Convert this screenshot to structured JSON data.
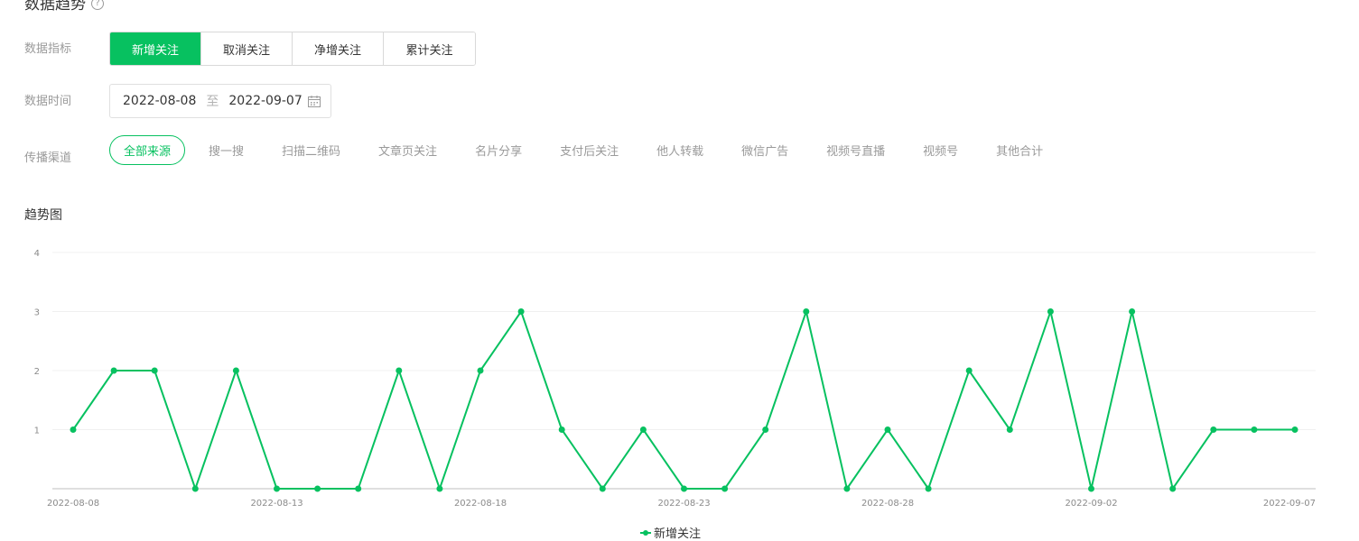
{
  "section": {
    "title": "数据趋势",
    "help_icon": "?"
  },
  "metric": {
    "label": "数据指标",
    "options": [
      "新增关注",
      "取消关注",
      "净增关注",
      "累计关注"
    ],
    "selected": "新增关注"
  },
  "date": {
    "label": "数据时间",
    "start": "2022-08-08",
    "separator": "至",
    "end": "2022-09-07",
    "icon": "calendar-icon"
  },
  "channel": {
    "label": "传播渠道",
    "options": [
      "全部来源",
      "搜一搜",
      "扫描二维码",
      "文章页关注",
      "名片分享",
      "支付后关注",
      "他人转载",
      "微信广告",
      "视频号直播",
      "视频号",
      "其他合计"
    ],
    "selected": "全部来源"
  },
  "chart": {
    "title": "趋势图"
  },
  "colors": {
    "accent": "#07c160",
    "muted": "#9a9a9a",
    "grid": "#f0f0f0",
    "axis": "#cccccc"
  },
  "chart_data": {
    "type": "line",
    "x": [
      "2022-08-08",
      "2022-08-09",
      "2022-08-10",
      "2022-08-11",
      "2022-08-12",
      "2022-08-13",
      "2022-08-14",
      "2022-08-15",
      "2022-08-16",
      "2022-08-17",
      "2022-08-18",
      "2022-08-19",
      "2022-08-20",
      "2022-08-21",
      "2022-08-22",
      "2022-08-23",
      "2022-08-24",
      "2022-08-25",
      "2022-08-26",
      "2022-08-27",
      "2022-08-28",
      "2022-08-29",
      "2022-08-30",
      "2022-08-31",
      "2022-09-01",
      "2022-09-02",
      "2022-09-03",
      "2022-09-04",
      "2022-09-05",
      "2022-09-06",
      "2022-09-07"
    ],
    "x_tick_labels": [
      "2022-08-08",
      "2022-08-13",
      "2022-08-18",
      "2022-08-23",
      "2022-08-28",
      "2022-09-02",
      "2022-09-07"
    ],
    "series": [
      {
        "name": "新增关注",
        "values": [
          1,
          2,
          2,
          0,
          2,
          0,
          0,
          0,
          2,
          0,
          2,
          3,
          1,
          0,
          1,
          0,
          0,
          1,
          3,
          0,
          1,
          0,
          2,
          1,
          3,
          0,
          3,
          0,
          1,
          1,
          1
        ]
      }
    ],
    "y_ticks": [
      1,
      2,
      3,
      4
    ],
    "ylim": [
      0,
      4
    ],
    "grid": true,
    "legend": "bottom-center"
  }
}
